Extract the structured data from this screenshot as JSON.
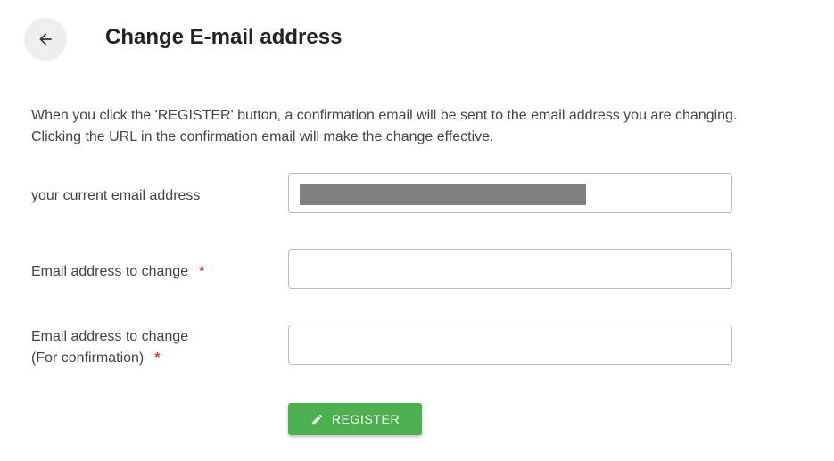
{
  "header": {
    "back_icon": "arrow-left-icon",
    "title": "Change E-mail address"
  },
  "description": {
    "line1": "When you click the 'REGISTER' button, a confirmation email will be sent to the email address you are changing.",
    "line2": "Clicking the URL in the confirmation email will make the change effective."
  },
  "form": {
    "current_email": {
      "label": "your current email address",
      "value": ""
    },
    "new_email": {
      "label": "Email address to change",
      "required_mark": "*",
      "value": ""
    },
    "confirm_email": {
      "label_line1": "Email address to change",
      "label_line2": "(For confirmation)",
      "required_mark": "*",
      "value": ""
    },
    "register_button": {
      "icon": "pencil-icon",
      "label": "REGISTER"
    }
  },
  "colors": {
    "accent": "#4caf50",
    "required": "#e53935",
    "masked_value": "#808080"
  }
}
